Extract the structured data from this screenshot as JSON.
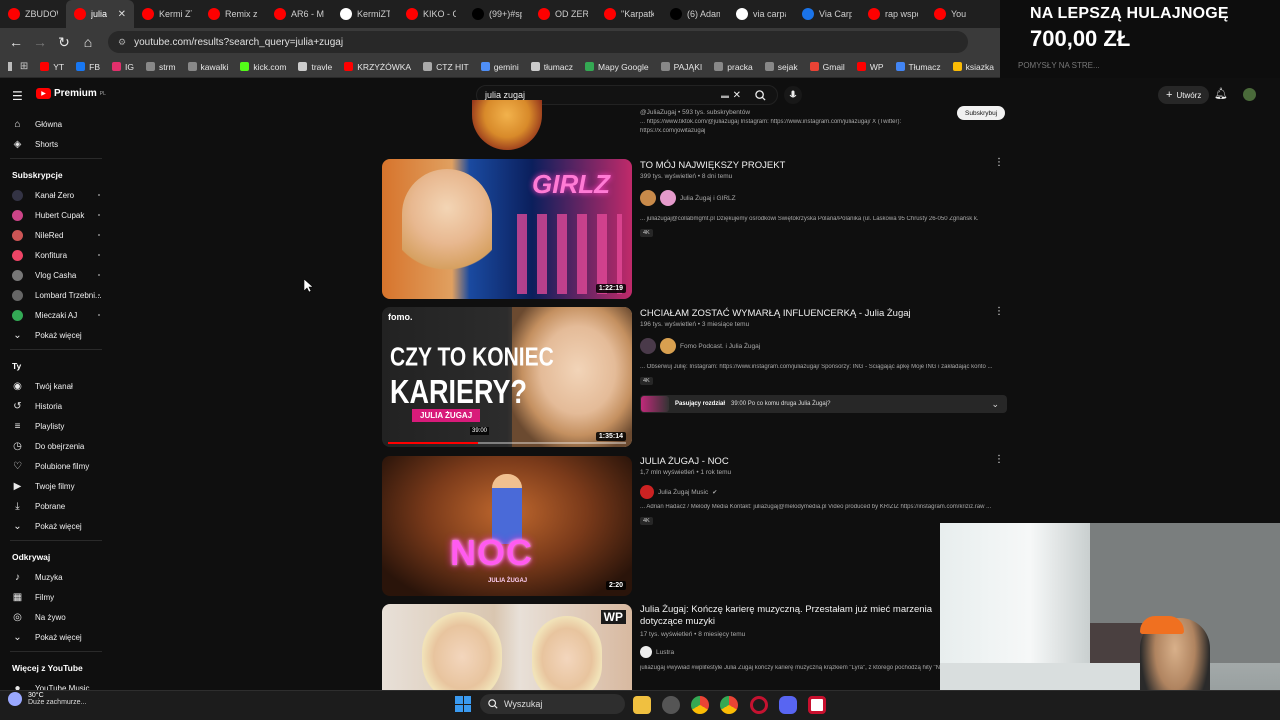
{
  "browser": {
    "tabs": [
      {
        "label": "ZBUDOWA",
        "fav": "#ff0000"
      },
      {
        "label": "julia zu",
        "fav": "#ff0000",
        "active": true
      },
      {
        "label": "Kermi ZTS",
        "fav": "#ff0000"
      },
      {
        "label": "Remix z Se",
        "fav": "#ff0000"
      },
      {
        "label": "AR6 - MAR",
        "fav": "#ff0000"
      },
      {
        "label": "KermiZTS",
        "fav": "#ffffff"
      },
      {
        "label": "KIKO - Ch",
        "fav": "#ff0000"
      },
      {
        "label": "(99+)#spe",
        "fav": "#000000"
      },
      {
        "label": "OD ZERA",
        "fav": "#ff0000"
      },
      {
        "label": "\"Karpatka",
        "fav": "#ff0000"
      },
      {
        "label": "(6) Adam",
        "fav": "#000000"
      },
      {
        "label": "via carpati",
        "fav": "#ffffff"
      },
      {
        "label": "Via Carpat",
        "fav": "#1a73e8"
      },
      {
        "label": "rap wspon",
        "fav": "#ff0000"
      },
      {
        "label": "You",
        "fav": "#ff0000"
      }
    ],
    "close_tab": "✕",
    "url": "youtube.com/results?search_query=julia+zugaj",
    "bookmarks": [
      {
        "label": "YT",
        "color": "#ff0000"
      },
      {
        "label": "FB",
        "color": "#1877f2"
      },
      {
        "label": "IG",
        "color": "#e1306c"
      },
      {
        "label": "strm",
        "color": "#888888"
      },
      {
        "label": "kawalki",
        "color": "#888888"
      },
      {
        "label": "kick.com",
        "color": "#53fc18"
      },
      {
        "label": "travle",
        "color": "#cccccc"
      },
      {
        "label": "KRZYŻÓWKA",
        "color": "#ff0000"
      },
      {
        "label": "CTZ HIT",
        "color": "#aaaaaa"
      },
      {
        "label": "gemini",
        "color": "#4f8ff7"
      },
      {
        "label": "tłumacz",
        "color": "#cccccc"
      },
      {
        "label": "Mapy Google",
        "color": "#34a853"
      },
      {
        "label": "PAJĄKI",
        "color": "#888888"
      },
      {
        "label": "pracka",
        "color": "#888888"
      },
      {
        "label": "sejak",
        "color": "#888888"
      },
      {
        "label": "Gmail",
        "color": "#ea4335"
      },
      {
        "label": "WP",
        "color": "#ff0000"
      },
      {
        "label": "Tłumacz",
        "color": "#4285f4"
      },
      {
        "label": "ksiazka",
        "color": "#fbbc05"
      }
    ]
  },
  "promo": {
    "line1": "NA LEPSZĄ HULAJNOGĘ",
    "line2": "700,00 ZŁ",
    "line3": "POMYSŁY NA STRE..."
  },
  "youtube": {
    "logo": "Premium",
    "logo_sup": "PL",
    "search_value": "julia zugaj",
    "create_label": "Utwórz",
    "subscribe_label": "Subskrybuj"
  },
  "sidebar": {
    "main": [
      {
        "label": "Główna",
        "icon": "⌂"
      },
      {
        "label": "Shorts",
        "icon": "◈"
      }
    ],
    "subs_header": "Subskrypcje",
    "subs": [
      {
        "label": "Kanał Zero",
        "color": "#334"
      },
      {
        "label": "Hubert Cupak",
        "color": "#c48"
      },
      {
        "label": "NileRed",
        "color": "#c55"
      },
      {
        "label": "Konfitura",
        "color": "#e46"
      },
      {
        "label": "Vlog Casha",
        "color": "#777"
      },
      {
        "label": "Lombard Trzebni...",
        "color": "#666"
      },
      {
        "label": "Mieczaki AJ",
        "color": "#3a5"
      }
    ],
    "show_more": "Pokaż więcej",
    "you_header": "Ty",
    "you": [
      {
        "label": "Twój kanał",
        "icon": "◉"
      },
      {
        "label": "Historia",
        "icon": "↺"
      },
      {
        "label": "Playlisty",
        "icon": "≡"
      },
      {
        "label": "Do obejrzenia",
        "icon": "◷"
      },
      {
        "label": "Polubione filmy",
        "icon": "♡"
      },
      {
        "label": "Twoje filmy",
        "icon": "▶"
      },
      {
        "label": "Pobrane",
        "icon": "⤓"
      },
      {
        "label": "Pokaż więcej",
        "icon": "⌄"
      }
    ],
    "explore_header": "Odkrywaj",
    "explore": [
      {
        "label": "Muzyka",
        "icon": "♪"
      },
      {
        "label": "Filmy",
        "icon": "▦"
      },
      {
        "label": "Na żywo",
        "icon": "◎"
      },
      {
        "label": "Pokaż więcej",
        "icon": "⌄"
      }
    ],
    "more_header": "Więcej z YouTube",
    "more": [
      {
        "label": "YouTube Music",
        "icon": "●"
      }
    ]
  },
  "channel_top": {
    "handle_line": "@JuliaZugaj • 593 tys. subskrybentów",
    "desc_1": "... https://www.tiktok.com/@juliazugaj Instagram: https://www.instagram.com/juliazugaj/ X (Twitter):",
    "desc_2": "https://x.com/jowitazugaj"
  },
  "videos": [
    {
      "title": "TO MÓJ NAJWIĘKSZY PROJEKT",
      "meta": "399 tys. wyświetleń • 8 dni temu",
      "channel": "Julia Żugaj i GIRLZ",
      "desc": "... juliazugaj@collabmgmt.pl Dziękujemy ośrodkowi Świętokrzyska Polana/Polanika (ul. Laskowa 95 Chrusty 26-050 Zgnańsk k.",
      "badge": "4K",
      "duration": "1:22:19",
      "thumb_text": "GIRLZ"
    },
    {
      "title": "CHCIAŁAM ZOSTAĆ WYMARŁĄ INFLUENCERKĄ - Julia Żugaj",
      "meta": "196 tys. wyświetleń • 3 miesiące temu",
      "channel": "Fomo Podcast. i Julia Żugaj",
      "desc": "... Obserwuj Julię: Instagram: https://www.instagram.com/juliazugaj/ Sponsorzy: ING - Ściągając apkę Moje ING i zakładając konto ...",
      "badge": "4K",
      "duration": "1:35:14",
      "thumb_line1": "CZY TO KONIEC",
      "thumb_line2": "KARIERY?",
      "thumb_name": "JULIA ŻUGAJ",
      "thumb_logo": "fomo.",
      "progress_time": "39:00",
      "chapter_label": "Pasujący rozdział",
      "chapter_text": "39:00 Po co komu druga Julia Żugaj?"
    },
    {
      "title": "JULIA ŻUGAJ - NOC",
      "meta": "1,7 mln wyświetleń • 1 rok temu",
      "channel": "Julia Żugaj Music",
      "desc": "... Adrian Hadacz / Melody Media Kontakt: juliazugaj@melodymedia.pl Video produced by KRIZIZ https://instagram.com/kriziz.raw ...",
      "badge": "4K",
      "duration": "2:20",
      "thumb_text": "NOC",
      "thumb_sub": "JULIA ŻUGAJ"
    },
    {
      "title": "Julia Żugaj: Kończę karierę muzyczną. Przestałam już mieć marzenia dotyczące muzyki",
      "meta": "17 tys. wyświetleń • 8 miesięcy temu",
      "channel": "Lustra",
      "desc": "juliazugaj #wywiad #wplifestyle Julia Żugaj kończy karierę muzyczną krążkiem \"Lyra\", z którego pochodzą hity \"N",
      "thumb_logo": "WP"
    }
  ],
  "taskbar": {
    "weather_temp": "30°C",
    "weather_desc": "Duże zachmurze...",
    "search_label": "Wyszukaj"
  }
}
